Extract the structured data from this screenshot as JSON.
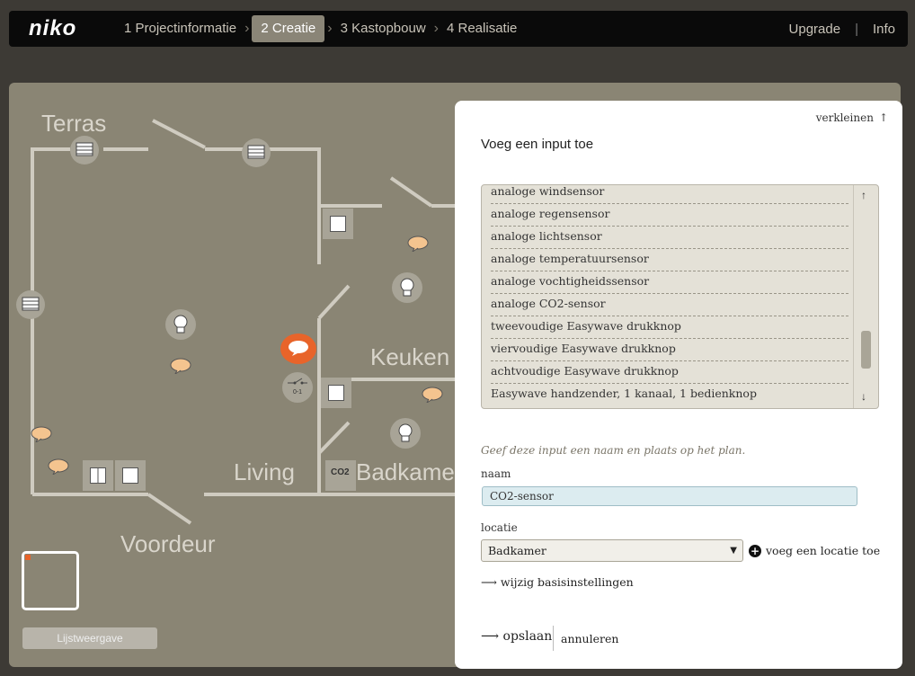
{
  "brand": "niko",
  "nav": {
    "steps": [
      "1 Projectinformatie",
      "2 Creatie",
      "3 Kastopbouw",
      "4 Realisatie"
    ],
    "upgrade": "Upgrade",
    "separator": "|",
    "info": "Info"
  },
  "plan": {
    "rooms": {
      "terras": "Terras",
      "keuken": "Keuken",
      "living": "Living",
      "badkamer": "Badkamer",
      "voordeur": "Voordeur"
    },
    "co2_label": "CO2",
    "switch_label": "0-1",
    "list_view_button": "Lijstweergave"
  },
  "panel": {
    "shrink": "verkleinen",
    "title": "Voeg een input toe",
    "items": [
      "analoge windsensor",
      "analoge regensensor",
      "analoge lichtsensor",
      "analoge temperatuursensor",
      "analoge vochtigheidssensor",
      "analoge CO2-sensor",
      "tweevoudige Easywave drukknop",
      "viervoudige Easywave drukknop",
      "achtvoudige Easywave drukknop",
      "Easywave handzender, 1 kanaal, 1 bedienknop"
    ],
    "hint": "Geef deze input een naam en plaats op het plan.",
    "name_label": "naam",
    "name_value": "CO2-sensor",
    "location_label": "locatie",
    "location_value": "Badkamer",
    "add_location": "voeg een locatie toe",
    "change_settings": "wijzig basisinstellingen",
    "save": "opslaan",
    "cancel": "annuleren"
  },
  "colors": {
    "accent": "#e8642a",
    "plan_bg": "#8a8574",
    "panel_bg": "#ffffff"
  }
}
